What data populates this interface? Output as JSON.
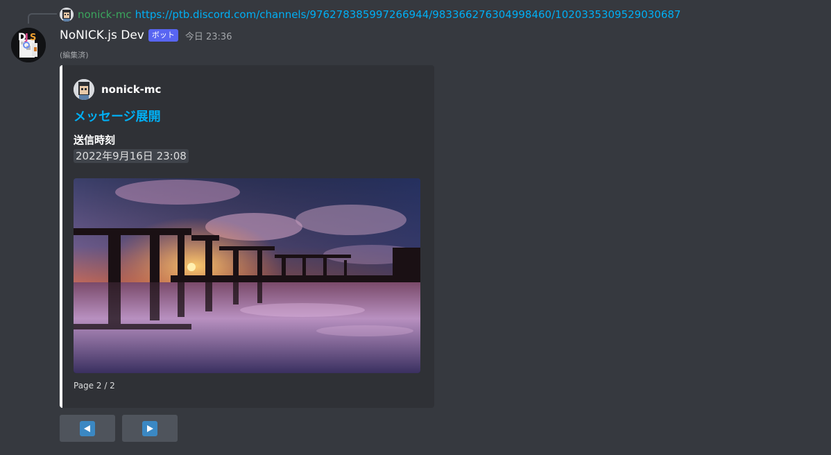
{
  "reply": {
    "username": "nonick-mc",
    "link": "https://ptb.discord.com/channels/976278385997266944/983366276304998460/1020335309529030687",
    "avatar_icon": "user-avatar-icon"
  },
  "message": {
    "author": "NoNICK.js Dev",
    "bot_tag": "ボット",
    "timestamp": "今日 23:36",
    "edited": "(編集済)",
    "avatar_icon": "bot-avatar-icon"
  },
  "embed": {
    "accent_color": "#ffffff",
    "author_name": "nonick-mc",
    "title": "メッセージ展開",
    "field_name": "送信時刻",
    "field_value": "2022年9月16日 23:08",
    "image_alt": "minecraft-sunset-bridge-screenshot",
    "footer": "Page 2 / 2"
  },
  "buttons": {
    "prev_icon": "arrow-left-icon",
    "next_icon": "arrow-right-icon",
    "button_color": "#4f545c",
    "icon_color": "#3b88c3"
  },
  "colors": {
    "background": "#36393f",
    "embed_bg": "#2f3136",
    "link": "#00aff4",
    "reply_user": "#3ba55d",
    "bot_tag": "#5865f2"
  }
}
